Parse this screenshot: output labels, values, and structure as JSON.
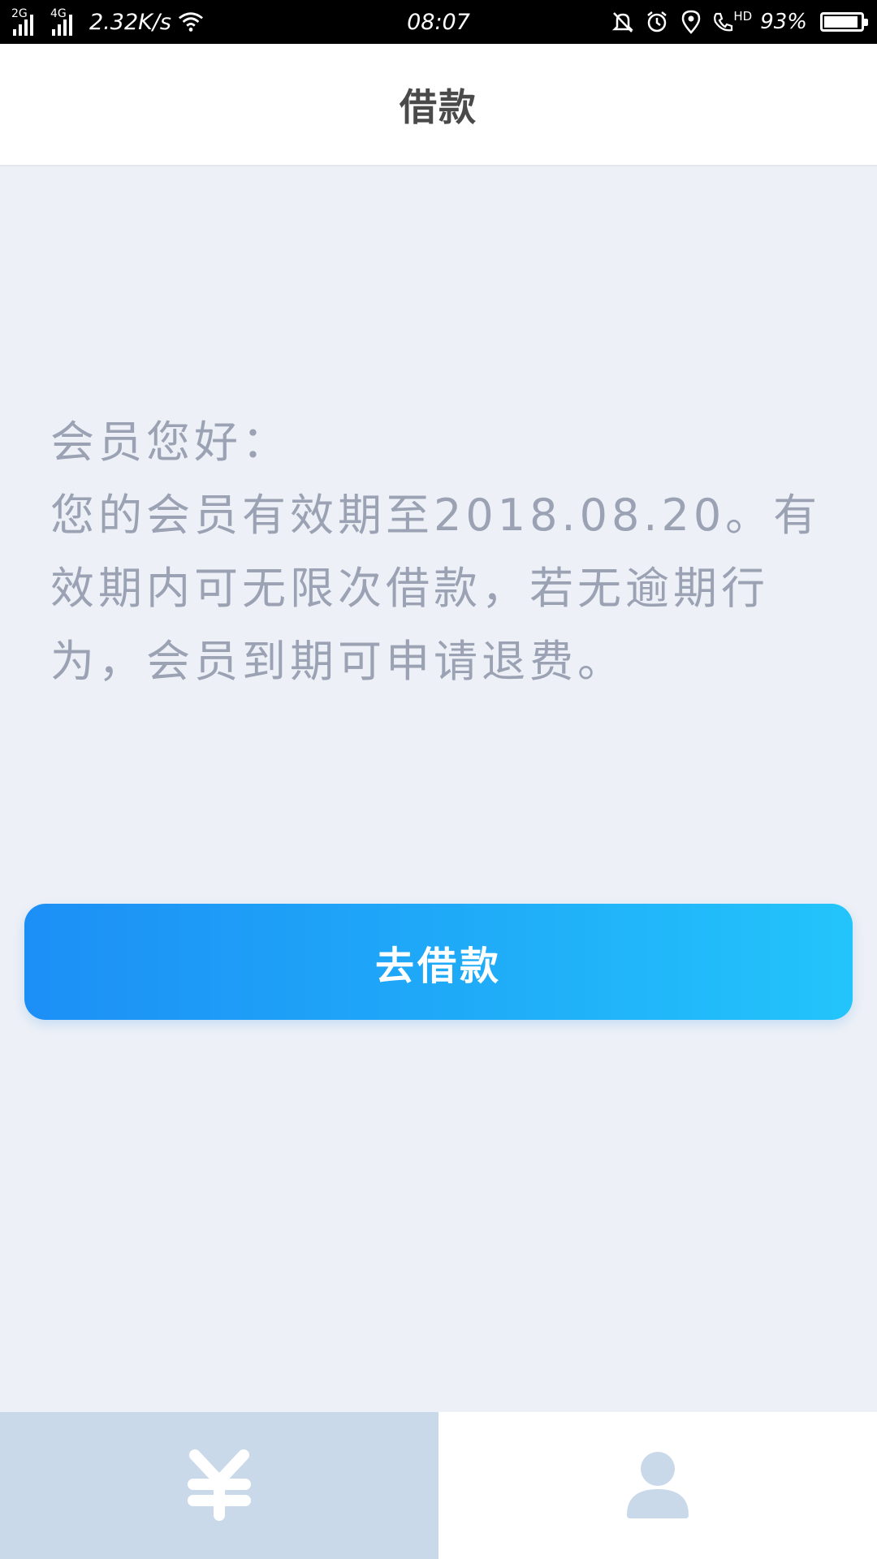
{
  "status_bar": {
    "network_1": "2G",
    "network_2": "4G",
    "speed": "2.32K/s",
    "time": "08:07",
    "volte": "HD",
    "battery": "93%",
    "battery_level": 0.93,
    "icons": [
      "signal-icon",
      "signal-icon",
      "wifi-icon",
      "bell-icon",
      "alarm-icon",
      "location-icon",
      "phone-icon",
      "battery-icon"
    ]
  },
  "header": {
    "title": "借款"
  },
  "message": {
    "greeting": "会员您好：",
    "line1": "您的会员有效期至2018.08.20。有",
    "line2": "效期内可无限次借款，若无逾期行",
    "line3": "为，会员到期可申请退费。"
  },
  "actions": {
    "borrow_label": "去借款"
  },
  "tabs": [
    {
      "icon": "yuan-icon",
      "active": true
    },
    {
      "icon": "user-icon",
      "active": false
    }
  ],
  "colors": {
    "background": "#edf0f6",
    "message_text": "#9aa2b3",
    "button_gradient_start": "#1c8ff6",
    "button_gradient_end": "#23c4fb",
    "active_tab": "#cad9ea",
    "tab_icon_active": "#ffffff",
    "tab_icon_inactive": "#c9d9ea"
  }
}
